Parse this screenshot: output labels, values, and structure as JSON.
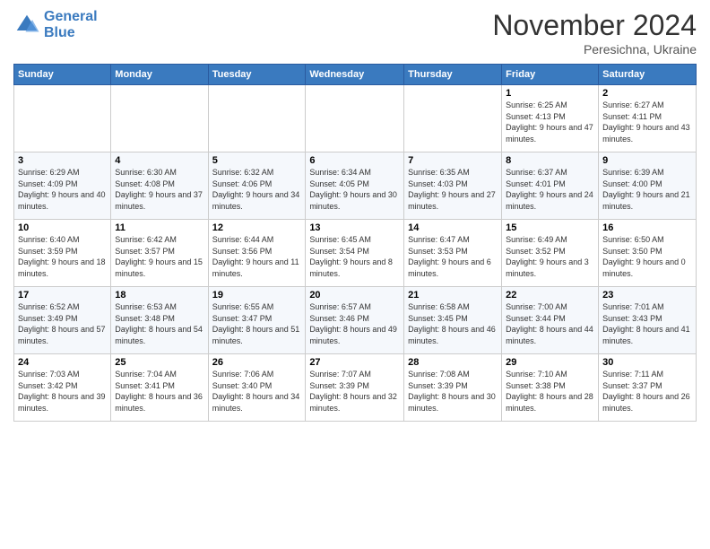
{
  "logo": {
    "line1": "General",
    "line2": "Blue"
  },
  "title": "November 2024",
  "location": "Peresichna, Ukraine",
  "weekdays": [
    "Sunday",
    "Monday",
    "Tuesday",
    "Wednesday",
    "Thursday",
    "Friday",
    "Saturday"
  ],
  "weeks": [
    [
      {
        "day": "",
        "sunrise": "",
        "sunset": "",
        "daylight": ""
      },
      {
        "day": "",
        "sunrise": "",
        "sunset": "",
        "daylight": ""
      },
      {
        "day": "",
        "sunrise": "",
        "sunset": "",
        "daylight": ""
      },
      {
        "day": "",
        "sunrise": "",
        "sunset": "",
        "daylight": ""
      },
      {
        "day": "",
        "sunrise": "",
        "sunset": "",
        "daylight": ""
      },
      {
        "day": "1",
        "sunrise": "Sunrise: 6:25 AM",
        "sunset": "Sunset: 4:13 PM",
        "daylight": "Daylight: 9 hours and 47 minutes."
      },
      {
        "day": "2",
        "sunrise": "Sunrise: 6:27 AM",
        "sunset": "Sunset: 4:11 PM",
        "daylight": "Daylight: 9 hours and 43 minutes."
      }
    ],
    [
      {
        "day": "3",
        "sunrise": "Sunrise: 6:29 AM",
        "sunset": "Sunset: 4:09 PM",
        "daylight": "Daylight: 9 hours and 40 minutes."
      },
      {
        "day": "4",
        "sunrise": "Sunrise: 6:30 AM",
        "sunset": "Sunset: 4:08 PM",
        "daylight": "Daylight: 9 hours and 37 minutes."
      },
      {
        "day": "5",
        "sunrise": "Sunrise: 6:32 AM",
        "sunset": "Sunset: 4:06 PM",
        "daylight": "Daylight: 9 hours and 34 minutes."
      },
      {
        "day": "6",
        "sunrise": "Sunrise: 6:34 AM",
        "sunset": "Sunset: 4:05 PM",
        "daylight": "Daylight: 9 hours and 30 minutes."
      },
      {
        "day": "7",
        "sunrise": "Sunrise: 6:35 AM",
        "sunset": "Sunset: 4:03 PM",
        "daylight": "Daylight: 9 hours and 27 minutes."
      },
      {
        "day": "8",
        "sunrise": "Sunrise: 6:37 AM",
        "sunset": "Sunset: 4:01 PM",
        "daylight": "Daylight: 9 hours and 24 minutes."
      },
      {
        "day": "9",
        "sunrise": "Sunrise: 6:39 AM",
        "sunset": "Sunset: 4:00 PM",
        "daylight": "Daylight: 9 hours and 21 minutes."
      }
    ],
    [
      {
        "day": "10",
        "sunrise": "Sunrise: 6:40 AM",
        "sunset": "Sunset: 3:59 PM",
        "daylight": "Daylight: 9 hours and 18 minutes."
      },
      {
        "day": "11",
        "sunrise": "Sunrise: 6:42 AM",
        "sunset": "Sunset: 3:57 PM",
        "daylight": "Daylight: 9 hours and 15 minutes."
      },
      {
        "day": "12",
        "sunrise": "Sunrise: 6:44 AM",
        "sunset": "Sunset: 3:56 PM",
        "daylight": "Daylight: 9 hours and 11 minutes."
      },
      {
        "day": "13",
        "sunrise": "Sunrise: 6:45 AM",
        "sunset": "Sunset: 3:54 PM",
        "daylight": "Daylight: 9 hours and 8 minutes."
      },
      {
        "day": "14",
        "sunrise": "Sunrise: 6:47 AM",
        "sunset": "Sunset: 3:53 PM",
        "daylight": "Daylight: 9 hours and 6 minutes."
      },
      {
        "day": "15",
        "sunrise": "Sunrise: 6:49 AM",
        "sunset": "Sunset: 3:52 PM",
        "daylight": "Daylight: 9 hours and 3 minutes."
      },
      {
        "day": "16",
        "sunrise": "Sunrise: 6:50 AM",
        "sunset": "Sunset: 3:50 PM",
        "daylight": "Daylight: 9 hours and 0 minutes."
      }
    ],
    [
      {
        "day": "17",
        "sunrise": "Sunrise: 6:52 AM",
        "sunset": "Sunset: 3:49 PM",
        "daylight": "Daylight: 8 hours and 57 minutes."
      },
      {
        "day": "18",
        "sunrise": "Sunrise: 6:53 AM",
        "sunset": "Sunset: 3:48 PM",
        "daylight": "Daylight: 8 hours and 54 minutes."
      },
      {
        "day": "19",
        "sunrise": "Sunrise: 6:55 AM",
        "sunset": "Sunset: 3:47 PM",
        "daylight": "Daylight: 8 hours and 51 minutes."
      },
      {
        "day": "20",
        "sunrise": "Sunrise: 6:57 AM",
        "sunset": "Sunset: 3:46 PM",
        "daylight": "Daylight: 8 hours and 49 minutes."
      },
      {
        "day": "21",
        "sunrise": "Sunrise: 6:58 AM",
        "sunset": "Sunset: 3:45 PM",
        "daylight": "Daylight: 8 hours and 46 minutes."
      },
      {
        "day": "22",
        "sunrise": "Sunrise: 7:00 AM",
        "sunset": "Sunset: 3:44 PM",
        "daylight": "Daylight: 8 hours and 44 minutes."
      },
      {
        "day": "23",
        "sunrise": "Sunrise: 7:01 AM",
        "sunset": "Sunset: 3:43 PM",
        "daylight": "Daylight: 8 hours and 41 minutes."
      }
    ],
    [
      {
        "day": "24",
        "sunrise": "Sunrise: 7:03 AM",
        "sunset": "Sunset: 3:42 PM",
        "daylight": "Daylight: 8 hours and 39 minutes."
      },
      {
        "day": "25",
        "sunrise": "Sunrise: 7:04 AM",
        "sunset": "Sunset: 3:41 PM",
        "daylight": "Daylight: 8 hours and 36 minutes."
      },
      {
        "day": "26",
        "sunrise": "Sunrise: 7:06 AM",
        "sunset": "Sunset: 3:40 PM",
        "daylight": "Daylight: 8 hours and 34 minutes."
      },
      {
        "day": "27",
        "sunrise": "Sunrise: 7:07 AM",
        "sunset": "Sunset: 3:39 PM",
        "daylight": "Daylight: 8 hours and 32 minutes."
      },
      {
        "day": "28",
        "sunrise": "Sunrise: 7:08 AM",
        "sunset": "Sunset: 3:39 PM",
        "daylight": "Daylight: 8 hours and 30 minutes."
      },
      {
        "day": "29",
        "sunrise": "Sunrise: 7:10 AM",
        "sunset": "Sunset: 3:38 PM",
        "daylight": "Daylight: 8 hours and 28 minutes."
      },
      {
        "day": "30",
        "sunrise": "Sunrise: 7:11 AM",
        "sunset": "Sunset: 3:37 PM",
        "daylight": "Daylight: 8 hours and 26 minutes."
      }
    ]
  ]
}
